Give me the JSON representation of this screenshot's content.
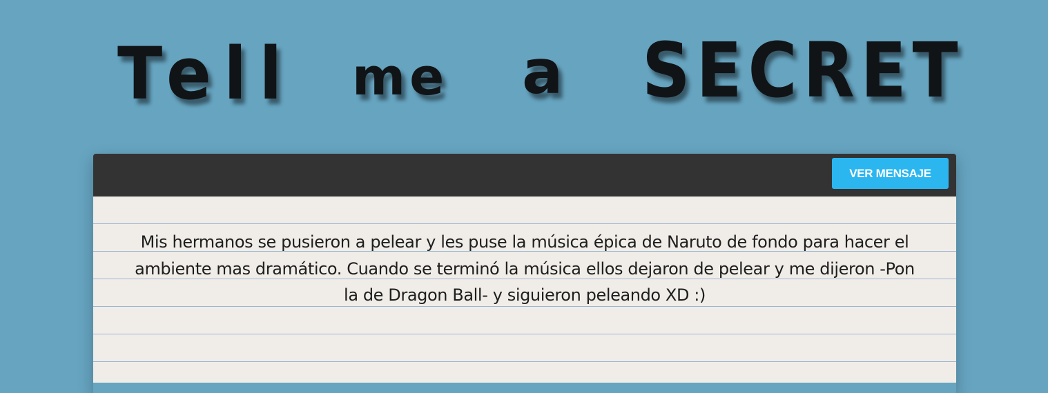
{
  "header": {
    "title_words": [
      "Tell",
      "me",
      "a",
      "SECRET"
    ]
  },
  "card": {
    "view_button_label": "VER MENSAJE",
    "message": "Mis hermanos se pusieron a pelear y les puse la música épica de Naruto de fondo para hacer el ambiente mas dramático. Cuando se terminó la música ellos dejaron de pelear y me dijeron -Pon la de Dragon Ball- y siguieron peleando XD :)"
  },
  "colors": {
    "background": "#66a4c0",
    "title_text": "#111417",
    "card_header": "#333333",
    "button": "#2bb6f0",
    "paper": "#f0ede8",
    "rule_line": "#9fb4d0"
  }
}
